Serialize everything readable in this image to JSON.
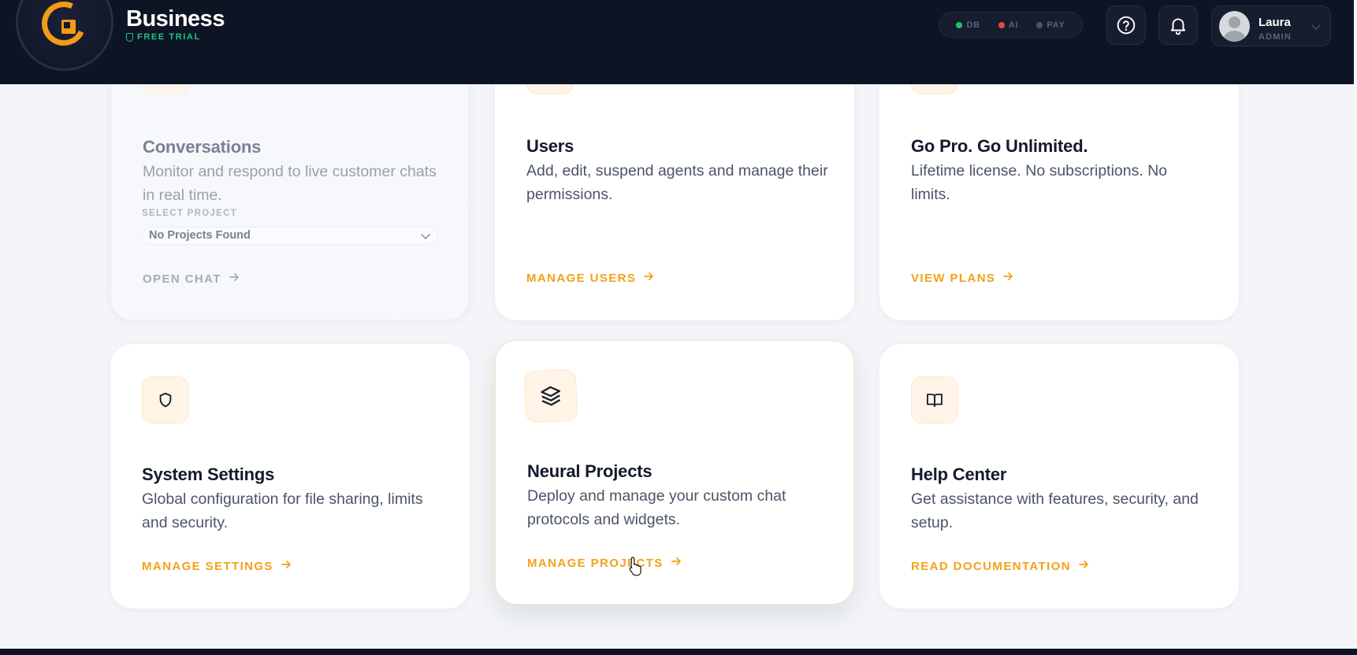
{
  "header": {
    "brand": "Business",
    "plan": "FREE TRIAL",
    "status": [
      {
        "label": "DB",
        "color": "#22c55e"
      },
      {
        "label": "AI",
        "color": "#ef4444"
      },
      {
        "label": "PAY",
        "color": "#4b5563"
      }
    ],
    "user": {
      "name": "Laura",
      "role": "ADMIN"
    }
  },
  "cards": {
    "conversations": {
      "title": "Conversations",
      "desc": "Monitor and respond to live customer chats in real time.",
      "select_label": "SELECT PROJECT",
      "select_value": "No Projects Found",
      "link": "OPEN CHAT"
    },
    "users": {
      "title": "Users",
      "desc": "Add, edit, suspend agents and manage their permissions.",
      "link": "MANAGE USERS"
    },
    "gopro": {
      "title": "Go Pro. Go Unlimited.",
      "desc": "Lifetime license. No subscriptions. No limits.",
      "link": "VIEW PLANS"
    },
    "settings": {
      "title": "System Settings",
      "desc": "Global configuration for file sharing, limits and security.",
      "link": "MANAGE SETTINGS"
    },
    "projects": {
      "title": "Neural Projects",
      "desc": "Deploy and manage your custom chat protocols and widgets.",
      "link": "MANAGE PROJECTS"
    },
    "help": {
      "title": "Help Center",
      "desc": "Get assistance with features, security, and setup.",
      "link": "READ DOCUMENTATION"
    }
  },
  "icons": {
    "accent": "#f2a218",
    "settings": "shield-icon",
    "projects": "layers-icon",
    "help": "book-icon"
  }
}
